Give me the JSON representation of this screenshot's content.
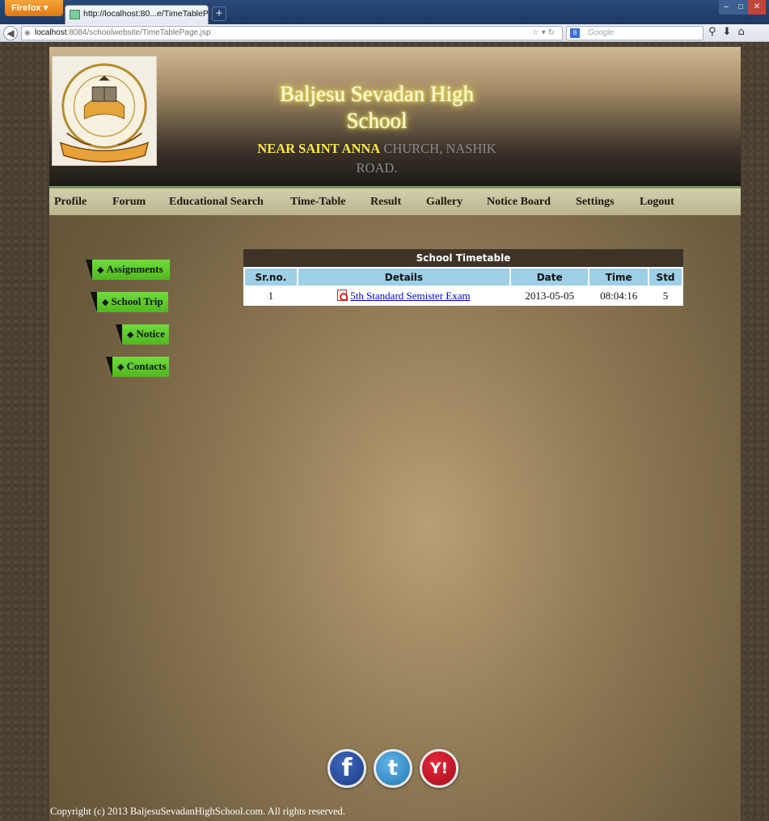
{
  "browser": {
    "app_button": "Firefox",
    "tab_title": "http://localhost:80...e/TimeTablePage.jsp",
    "url_host": "localhost",
    "url_path": ":8084/schoolwebsite/TimeTablePage.jsp",
    "search_placeholder": "Google"
  },
  "header": {
    "school_name": "Baljesu Sevadan High School",
    "address_highlight": "NEAR SAINT ANNA",
    "address_rest": " CHURCH, NASHIK ROAD."
  },
  "menu": {
    "items": [
      "Profile",
      "Forum",
      "Educational Search",
      "Time-Table",
      "Result",
      "Gallery",
      "Notice Board",
      "Settings",
      "Logout"
    ]
  },
  "sidenav": {
    "items": [
      "Assignments",
      "School Trip",
      "Notice",
      "Contacts"
    ]
  },
  "timetable": {
    "caption": "School Timetable",
    "columns": [
      "Sr.no.",
      "Details",
      "Date",
      "Time",
      "Std"
    ],
    "rows": [
      [
        "1",
        "5th Standard Semister Exam",
        "2013-05-05",
        "08:04:16",
        "5"
      ]
    ]
  },
  "social": {
    "icons": [
      "facebook-icon",
      "twitter-icon",
      "yahoo-icon"
    ]
  },
  "footer": {
    "copyright": "Copyright (c) 2013 BaljesuSevadanHighSchool.com. All rights reserved."
  },
  "colors": {
    "menu_bg": "#c6c29d",
    "side_button": "#5cc82a",
    "table_header": "#9dcfe6",
    "caption_bg": "#3d3427",
    "title_glow": "#ffea3a"
  }
}
